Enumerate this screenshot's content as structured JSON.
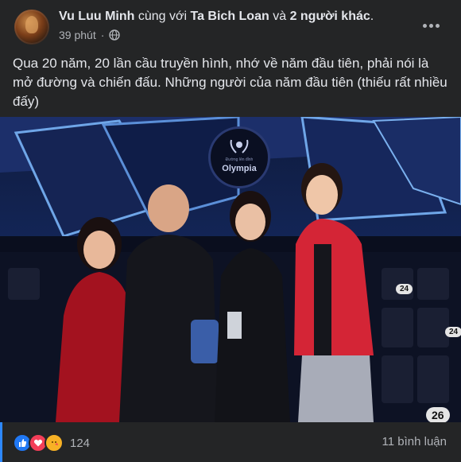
{
  "post": {
    "author": "Vu Luu Minh",
    "with_text": "cùng với",
    "tagged": "Ta Bich Loan",
    "and_text": "và",
    "others": "2 người khác",
    "period": ".",
    "time": "39 phút",
    "separator": "·",
    "privacy_icon": "globe-icon",
    "text": "Qua 20 năm, 20 lần cầu truyền hình, nhớ về năm đầu tiên, phải nói là mở đường và chiến đấu. Những người của năm đầu tiên (thiếu rất nhiều đấy)"
  },
  "photo": {
    "logo_small_text": "Đường lên đỉnh",
    "logo_big_text": "Olympia",
    "seat_numbers": [
      "24",
      "24",
      "26"
    ]
  },
  "footer": {
    "reaction_icons": [
      "like-icon",
      "love-icon",
      "care-icon"
    ],
    "reaction_count": "124",
    "comments": "11 bình luận"
  },
  "colors": {
    "background": "#242526",
    "text_primary": "#e4e6eb",
    "text_secondary": "#b0b3b8",
    "like": "#2078f4",
    "love": "#f33e58",
    "care": "#f7b125"
  }
}
